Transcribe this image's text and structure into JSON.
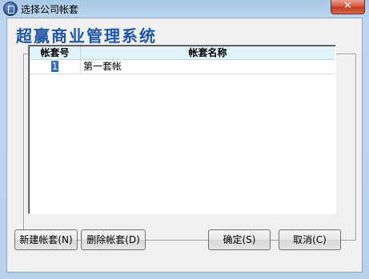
{
  "window": {
    "title": "选择公司帐套",
    "close_label": "✕"
  },
  "banner": {
    "text": "超赢商业管理系统"
  },
  "table": {
    "columns": [
      "帐套号",
      "帐套名称"
    ],
    "rows": [
      {
        "id": "1",
        "name": "第一套帐"
      }
    ]
  },
  "buttons": {
    "new_label": "新建帐套(N)",
    "delete_label": "删除帐套(D)",
    "ok_label": "确定(S)",
    "cancel_label": "取消(C)"
  },
  "colors": {
    "banner_text": "#1f57a6",
    "header_bg": "#dff3f8",
    "selection": "#3169c6"
  },
  "icons": {
    "app": "app-icon",
    "close": "close-icon"
  }
}
